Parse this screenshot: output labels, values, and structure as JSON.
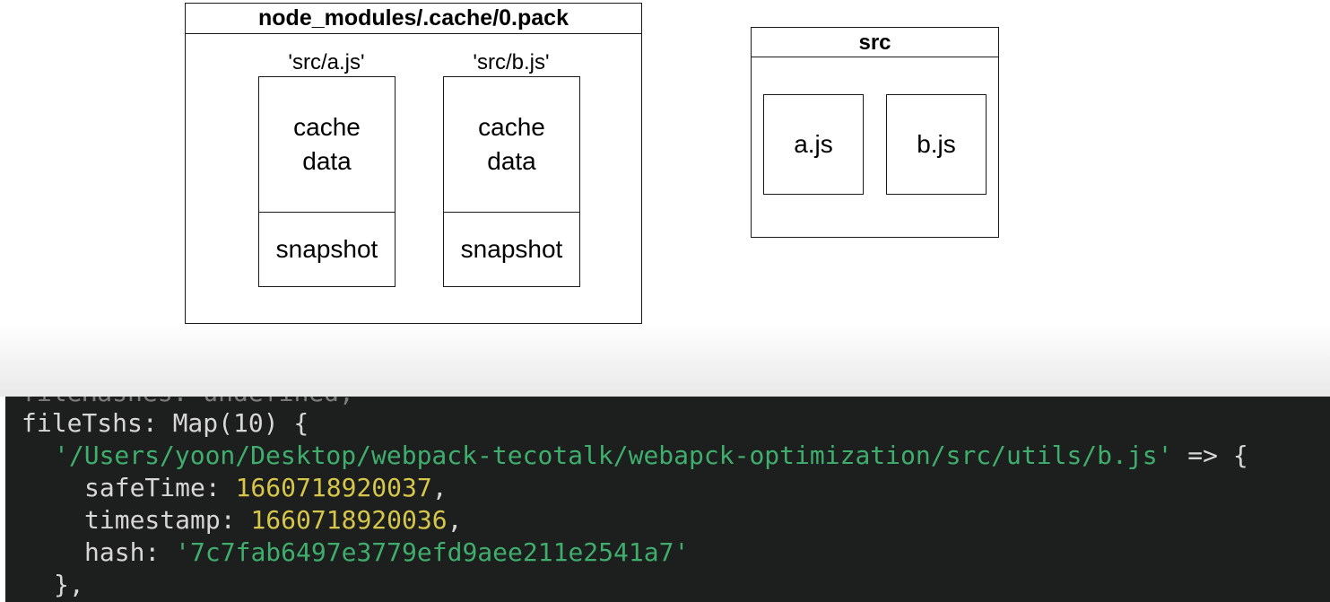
{
  "diagram": {
    "pack_title": "node_modules/.cache/0.pack",
    "entries": [
      {
        "label": "'src/a.js'",
        "cache_line1": "cache",
        "cache_line2": "data",
        "snapshot": "snapshot"
      },
      {
        "label": "'src/b.js'",
        "cache_line1": "cache",
        "cache_line2": "data",
        "snapshot": "snapshot"
      }
    ],
    "src_title": "src",
    "src_files": [
      "a.js",
      "b.js"
    ]
  },
  "terminal": {
    "line0_key": "fileHashes: ",
    "line0_val": "undefined,",
    "line1": "fileTshs: Map(10) {",
    "path": "'/Users/yoon/Desktop/webpack-tecotalk/webapck-optimization/src/utils/b.js'",
    "arrow": " => {",
    "safeTime_key": "safeTime: ",
    "safeTime_val": "1660718920037",
    "timestamp_key": "timestamp: ",
    "timestamp_val": "1660718920036",
    "hash_key": "hash: ",
    "hash_val": "'7c7fab6497e3779efd9aee211e2541a7'",
    "close": "},"
  }
}
